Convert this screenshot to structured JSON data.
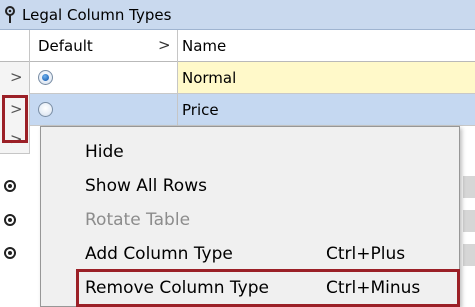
{
  "panel": {
    "title": "Legal Column Types",
    "pin_icon": "pin-icon"
  },
  "table": {
    "columns": [
      "Default",
      "Name"
    ],
    "sort_indicator": ">",
    "rows": [
      {
        "chevron": ">",
        "default_selected": true,
        "name": "Normal"
      },
      {
        "chevron": ">",
        "default_selected": false,
        "name": "Price"
      }
    ],
    "stub_chevron": ">"
  },
  "context_menu": {
    "items": [
      {
        "label": "Hide",
        "shortcut": "",
        "enabled": true
      },
      {
        "label": "Show All Rows",
        "shortcut": "",
        "enabled": true
      },
      {
        "label": "Rotate Table",
        "shortcut": "",
        "enabled": false
      },
      {
        "label": "Add Column Type",
        "shortcut": "Ctrl+Plus",
        "enabled": true
      },
      {
        "label": "Remove Column Type",
        "shortcut": "Ctrl+Minus",
        "enabled": true
      }
    ]
  },
  "colors": {
    "title_bar": "#c9d9ee",
    "selected_row": "#c5d8f1",
    "name_cell_highlight": "#fff9c9",
    "annotation_box": "#9b2027",
    "menu_background": "#f0f0f0"
  }
}
